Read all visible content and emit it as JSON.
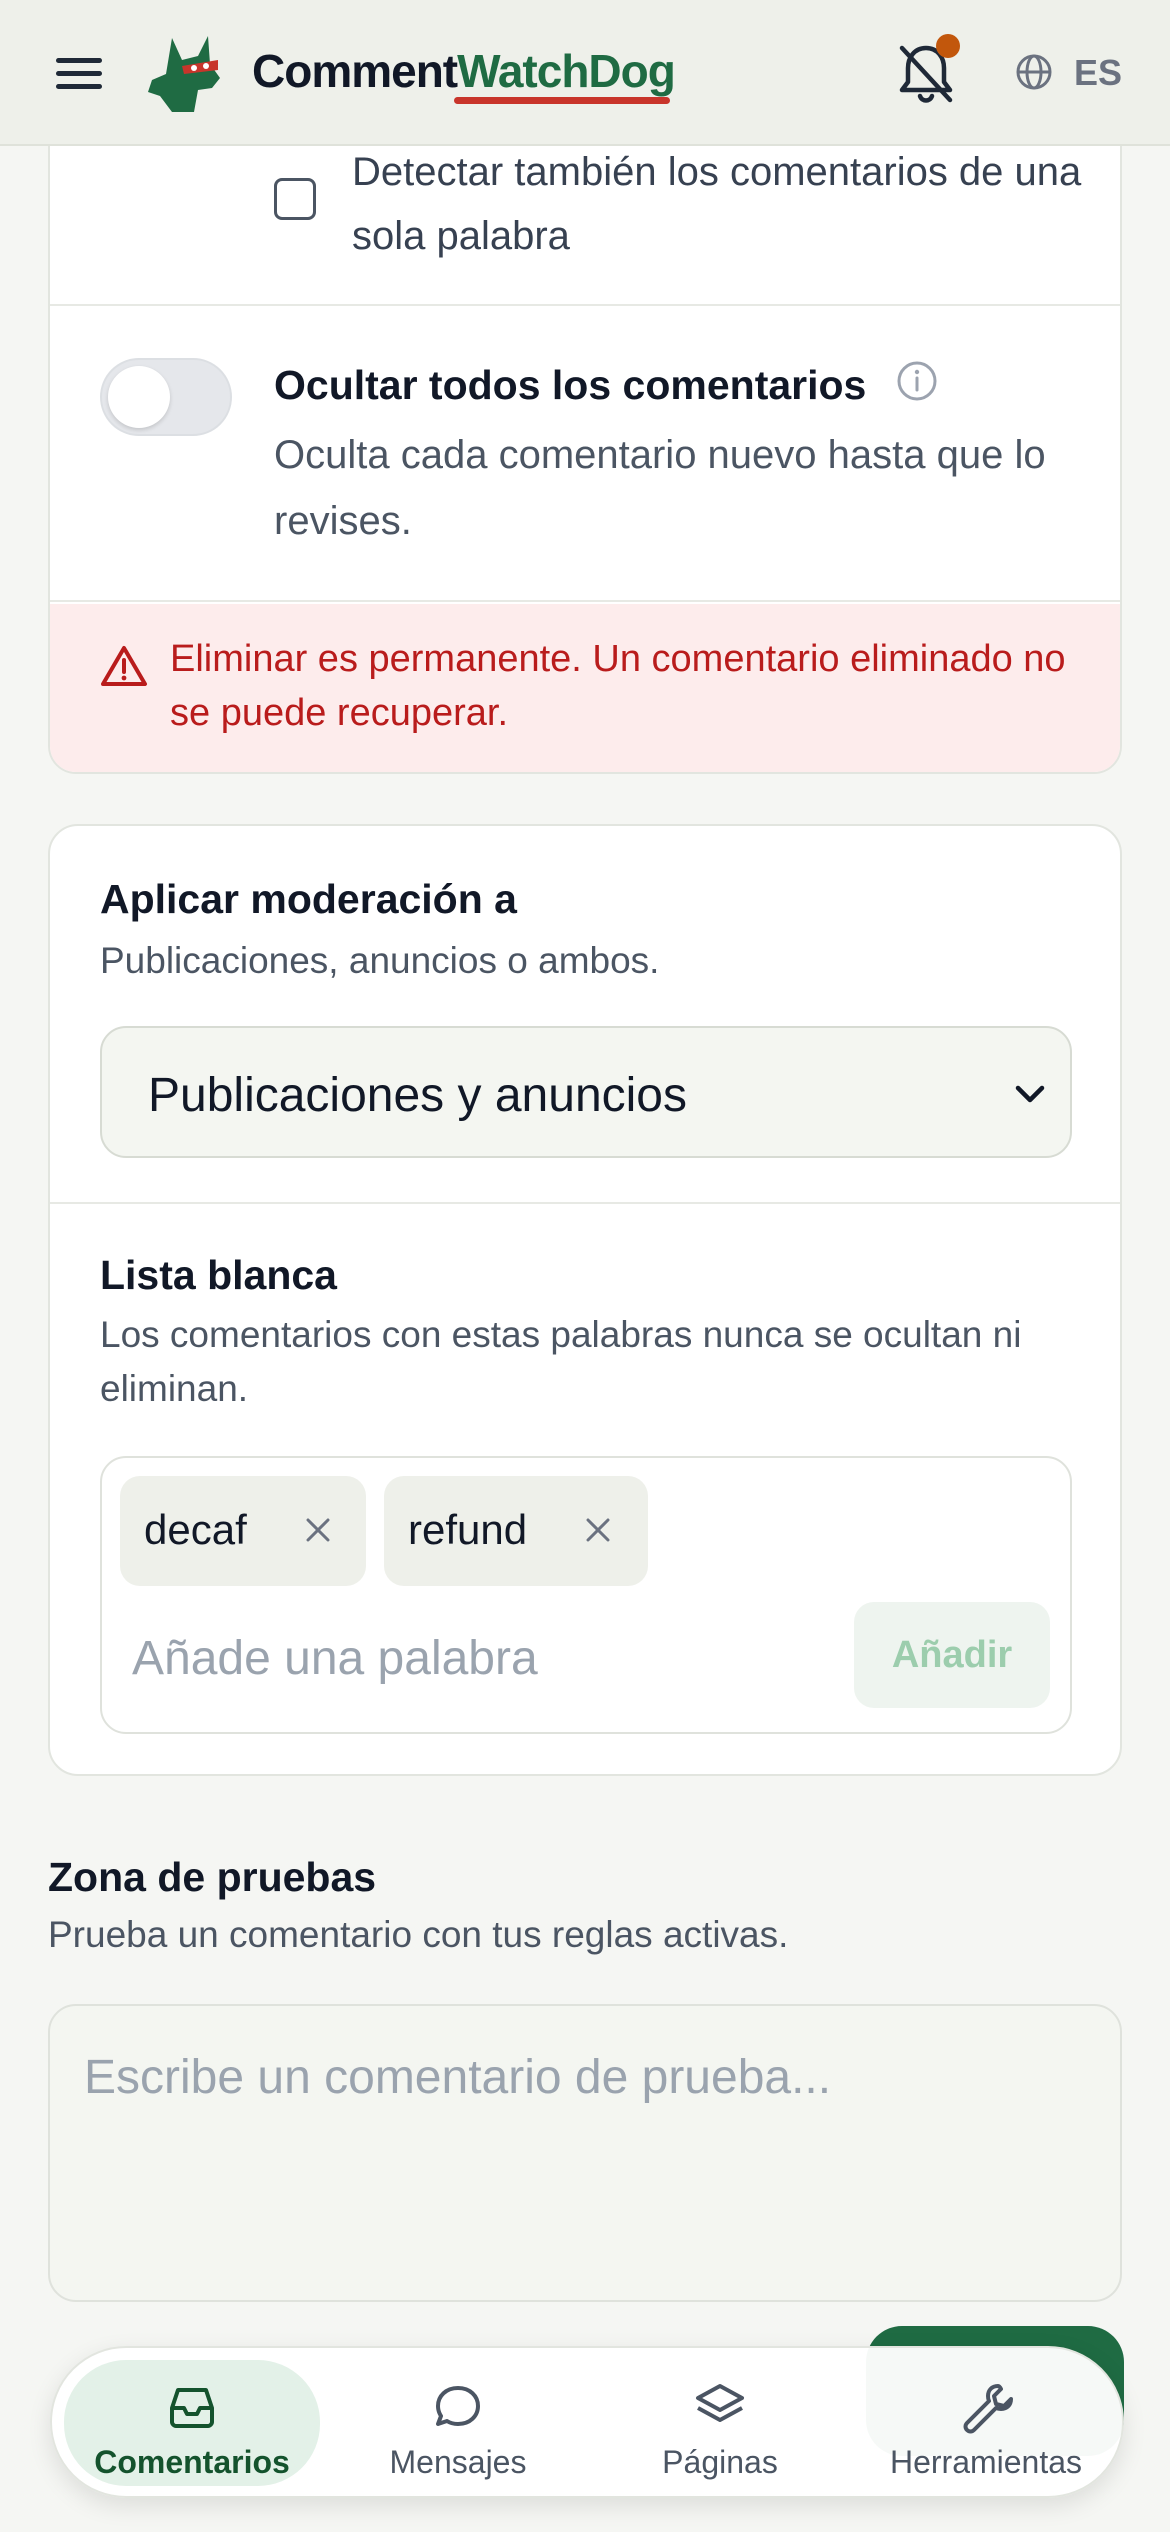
{
  "header": {
    "brand_part1": "Comment",
    "brand_part2": "WatchDog",
    "language": "ES",
    "icons": [
      "menu-icon",
      "logo-icon",
      "bell-off-icon",
      "globe-icon"
    ]
  },
  "options": {
    "single_word_label": "Detectar también los comentarios de una sola palabra",
    "single_word_checked": false,
    "hide_all_title": "Ocultar todos los comentarios",
    "hide_all_desc": "Oculta cada comentario nuevo hasta que lo revises.",
    "hide_all_enabled": false,
    "warning": "Eliminar es permanente. Un comentario eliminado no se puede recuperar."
  },
  "moderation": {
    "title": "Aplicar moderación a",
    "desc": "Publicaciones, anuncios o ambos.",
    "selected": "Publicaciones y anuncios"
  },
  "whitelist": {
    "title": "Lista blanca",
    "desc": "Los comentarios con estas palabras nunca se ocultan ni eliminan.",
    "chips": [
      "decaf",
      "refund"
    ],
    "input_placeholder": "Añade una palabra",
    "add_label": "Añadir"
  },
  "test_zone": {
    "title": "Zona de pruebas",
    "desc": "Prueba un comentario con tus reglas activas.",
    "placeholder": "Escribe un comentario de prueba..."
  },
  "nav": {
    "items": [
      {
        "label": "Comentarios",
        "icon": "inbox-icon",
        "active": true
      },
      {
        "label": "Mensajes",
        "icon": "chat-bubble-icon",
        "active": false
      },
      {
        "label": "Páginas",
        "icon": "layers-icon",
        "active": false
      },
      {
        "label": "Herramientas",
        "icon": "wrench-icon",
        "active": false
      }
    ]
  },
  "colors": {
    "brand_green": "#1f6b43",
    "accent_red": "#c8352b",
    "warning_text": "#b91c1c",
    "warning_bg": "#fdecec",
    "notification_dot": "#c2570c"
  }
}
